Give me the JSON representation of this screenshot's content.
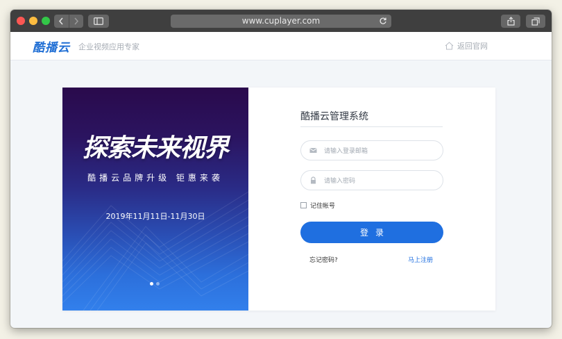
{
  "browser": {
    "url": "www.cuplayer.com"
  },
  "header": {
    "logo": "酷播云",
    "slogan": "企业视频应用专家",
    "back_link": "返回官网"
  },
  "banner": {
    "title": "探索未来视界",
    "subtitle": "酷播云品牌升级 钜惠来袭",
    "date_range": "2019年11月11日-11月30日",
    "slide_count": 2,
    "active_slide": 1
  },
  "login": {
    "title": "酷播云管理系统",
    "email_placeholder": "请输入登录邮箱",
    "password_placeholder": "请输入密码",
    "remember_label": "记住帐号",
    "submit_label": "登录",
    "forgot_label": "忘记密码?",
    "register_label": "马上注册"
  },
  "colors": {
    "accent": "#1f6fe0",
    "logo": "#1f6ed4"
  }
}
